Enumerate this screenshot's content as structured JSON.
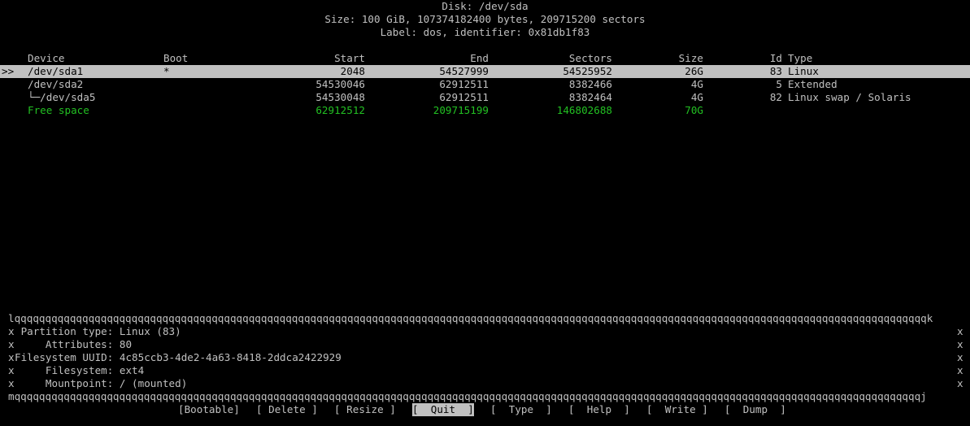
{
  "header": {
    "disk": "Disk: /dev/sda",
    "size": "Size: 100 GiB, 107374182400 bytes, 209715200 sectors",
    "label": "Label: dos, identifier: 0x81db1f83"
  },
  "columns": {
    "device": "Device",
    "boot": "Boot",
    "start": "Start",
    "end": "End",
    "sectors": "Sectors",
    "size": "Size",
    "id": "Id",
    "type": "Type"
  },
  "selector": ">>",
  "rows": [
    {
      "device": "/dev/sda1",
      "boot": "*",
      "start": "2048",
      "end": "54527999",
      "sectors": "54525952",
      "size": "26G",
      "id": "83",
      "type": "Linux"
    },
    {
      "device": "/dev/sda2",
      "boot": "",
      "start": "54530046",
      "end": "62912511",
      "sectors": "8382466",
      "size": "4G",
      "id": "5",
      "type": "Extended"
    },
    {
      "device": "└─/dev/sda5",
      "boot": "",
      "start": "54530048",
      "end": "62912511",
      "sectors": "8382464",
      "size": "4G",
      "id": "82",
      "type": "Linux swap / Solaris"
    },
    {
      "device": "Free space",
      "boot": "",
      "start": "62912512",
      "end": "209715199",
      "sectors": "146802688",
      "size": "70G",
      "id": "",
      "type": ""
    }
  ],
  "info": {
    "border_top": "lqqqqqqqqqqqqqqqqqqqqqqqqqqqqqqqqqqqqqqqqqqqqqqqqqqqqqqqqqqqqqqqqqqqqqqqqqqqqqqqqqqqqqqqqqqqqqqqqqqqqqqqqqqqqqqqqqqqqqqqqqqqqqqqqqqqqqqqqqqqqqqqqqqqqk",
    "border_bottom": "mqqqqqqqqqqqqqqqqqqqqqqqqqqqqqqqqqqqqqqqqqqqqqqqqqqqqqqqqqqqqqqqqqqqqqqqqqqqqqqqqqqqqqqqqqqqqqqqqqqqqqqqqqqqqqqqqqqqqqqqqqqqqqqqqqqqqqqqqqqqqqqqqqqqj",
    "side": "x",
    "lines": [
      " Partition type: Linux (83)",
      "     Attributes: 80",
      "Filesystem UUID: 4c85ccb3-4de2-4a63-8418-2ddca2422929",
      "     Filesystem: ext4",
      "     Mountpoint: / (mounted)"
    ]
  },
  "menu": {
    "bootable": "[Bootable]",
    "delete": "[ Delete ]",
    "resize": "[ Resize ]",
    "quit": "[  Quit  ]",
    "type": "[  Type  ]",
    "help": "[  Help  ]",
    "write": "[  Write ]",
    "dump": "[  Dump  ]"
  }
}
